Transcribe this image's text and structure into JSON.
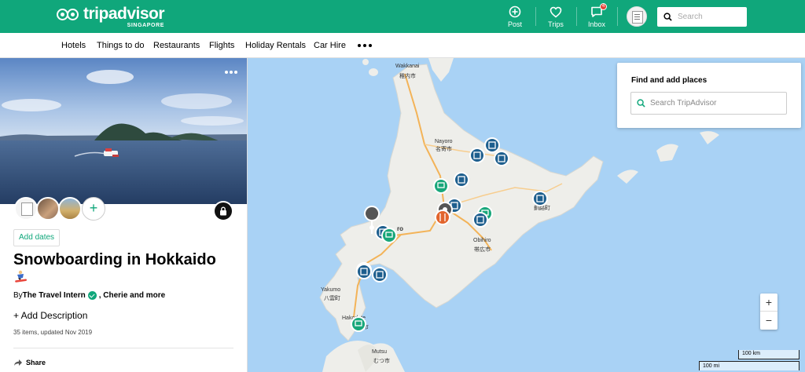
{
  "header": {
    "brand": "tripadvisor",
    "brand_sub": "SINGAPORE",
    "nav_icons": [
      {
        "label": "Post",
        "icon": "plus-circle-icon"
      },
      {
        "label": "Trips",
        "icon": "heart-icon"
      },
      {
        "label": "Inbox",
        "icon": "chat-icon",
        "badge": "4"
      }
    ],
    "search_placeholder": "Search",
    "accent_color": "#10a77b"
  },
  "nav": {
    "items": [
      "Hotels",
      "Things to do",
      "Restaurants",
      "Flights",
      "Holiday Rentals",
      "Car Hire"
    ]
  },
  "trip": {
    "add_dates": "Add dates",
    "title": "Snowboarding in Hokkaido",
    "by_prefix": "By ",
    "author": "The Travel Intern",
    "coauthors": ", Cherie and more",
    "add_description": "+ Add Description",
    "meta": "35 items, updated Nov 2019",
    "share": "Share"
  },
  "map": {
    "find_title": "Find and add places",
    "find_placeholder": "Search TripAdvisor",
    "zoom_in": "+",
    "zoom_out": "−",
    "scale_km": "100 km",
    "scale_mi": "100 mi",
    "places": {
      "wakkanai_en": "Wakkanai",
      "wakkanai_jp": "稚内市",
      "nayoro_en": "Nayoro",
      "nayoro_jp": "名寄市",
      "ro": "ro",
      "nemuro": "aga",
      "nemuro_jp": "釧路町",
      "obihiro_en": "Obihiro",
      "obihiro_jp": "帯広市",
      "yakumo_en": "Yakumo",
      "yakumo_jp": "八雲町",
      "hakodate_en": "Hakodate",
      "hakodate_jp": "函館市",
      "mutsu_en": "Mutsu",
      "mutsu_jp": "むつ市"
    }
  }
}
